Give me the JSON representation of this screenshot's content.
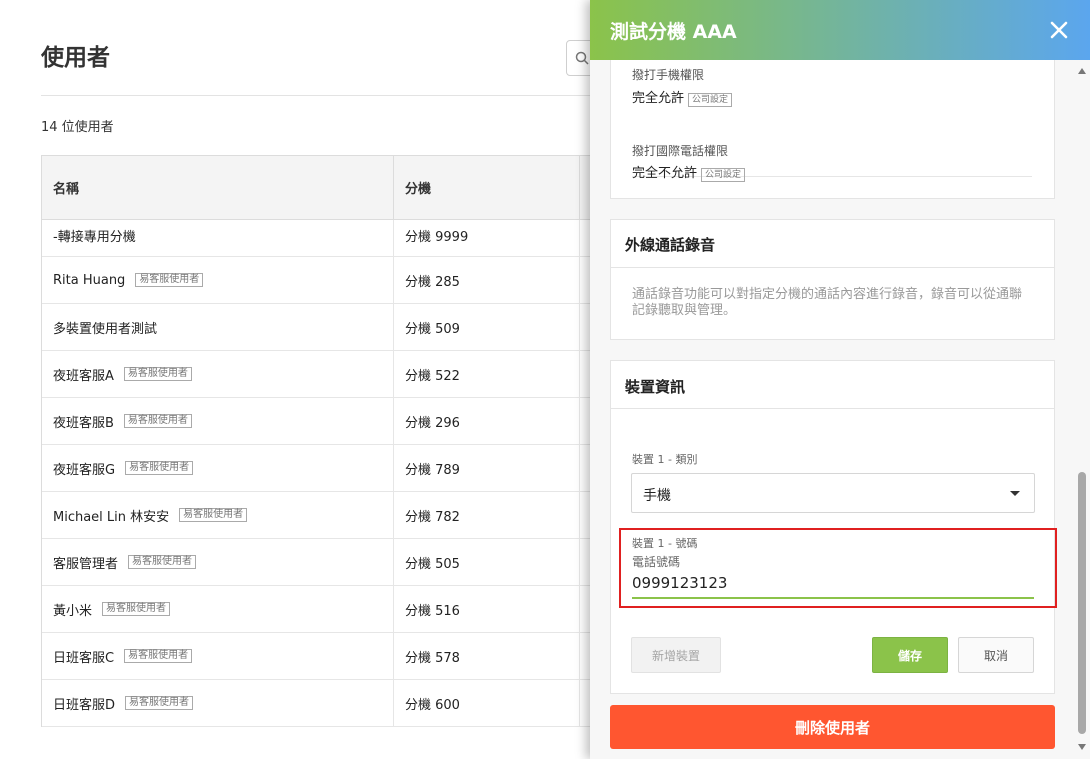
{
  "page": {
    "title": "使用者",
    "user_count": "14 位使用者",
    "columns": {
      "name": "名稱",
      "extension": "分機"
    },
    "users": [
      {
        "name": "-轉接專用分機",
        "tag": "",
        "ext": "分機 9999"
      },
      {
        "name": "Rita Huang",
        "tag": "易客服使用者",
        "ext": "分機 285"
      },
      {
        "name": "多裝置使用者測試",
        "tag": "",
        "ext": "分機 509"
      },
      {
        "name": "夜班客服A",
        "tag": "易客服使用者",
        "ext": "分機 522"
      },
      {
        "name": "夜班客服B",
        "tag": "易客服使用者",
        "ext": "分機 296"
      },
      {
        "name": "夜班客服G",
        "tag": "易客服使用者",
        "ext": "分機 789"
      },
      {
        "name": "Michael Lin 林安安",
        "tag": "易客服使用者",
        "ext": "分機 782"
      },
      {
        "name": "客服管理者",
        "tag": "易客服使用者",
        "ext": "分機 505"
      },
      {
        "name": "黃小米",
        "tag": "易客服使用者",
        "ext": "分機 516"
      },
      {
        "name": "日班客服C",
        "tag": "易客服使用者",
        "ext": "分機 578"
      },
      {
        "name": "日班客服D",
        "tag": "易客服使用者",
        "ext": "分機 600"
      }
    ]
  },
  "drawer": {
    "title": "測試分機 AAA",
    "permissions": {
      "mobile_label": "撥打手機權限",
      "mobile_value": "完全允許",
      "mobile_tag": "公司設定",
      "intl_label": "撥打國際電話權限",
      "intl_value": "完全不允許",
      "intl_tag": "公司設定"
    },
    "recording": {
      "title": "外線通話錄音",
      "description": "通話錄音功能可以對指定分機的通話內容進行錄音，錄音可以從通聯記錄聽取與管理。"
    },
    "device": {
      "title": "裝置資訊",
      "type_label": "裝置 1 - 類別",
      "type_value": "手機",
      "number_label": "裝置 1 - 號碼",
      "number_sublabel": "電話號碼",
      "number_value": "0999123123",
      "add_label": "新增裝置",
      "save_label": "儲存",
      "cancel_label": "取消"
    },
    "delete_label": "刪除使用者"
  },
  "colors": {
    "accent_green": "#8bc34a",
    "header_blue": "#5ba6ee",
    "danger": "#ff5630",
    "highlight": "#e02020"
  }
}
